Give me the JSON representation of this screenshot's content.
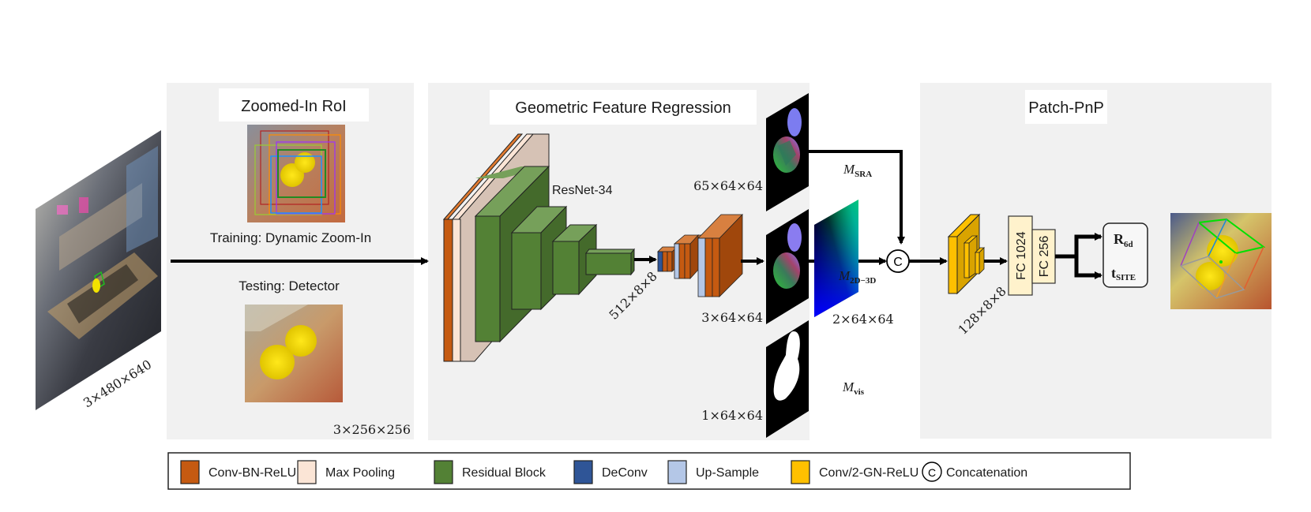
{
  "panels": {
    "roi": {
      "title": "Zoomed-In RoI",
      "training_label": "Training: Dynamic Zoom-In",
      "testing_label": "Testing: Detector",
      "output_dim": "3×256×256"
    },
    "gfr": {
      "title": "Geometric Feature Regression",
      "backbone_label": "ResNet-34",
      "bottleneck_dim": "512×8×8",
      "srа_dim": "65×64×64",
      "xyz_dim": "3×64×64",
      "mask_dim": "1×64×64"
    },
    "pnp": {
      "title": "Patch-PnP",
      "conv_dim": "128×8×8",
      "fc1_label": "FC 1024",
      "fc2_label": "FC 256",
      "rot_label": "R",
      "rot_sub": "6d",
      "trans_label": "t",
      "trans_sub": "SITE"
    }
  },
  "input": {
    "dim": "3×480×640"
  },
  "maps": {
    "sra": {
      "symbol": "M",
      "sub": "SRA"
    },
    "coord2d3d": {
      "symbol": "M",
      "sub": "2D−3D",
      "dim": "2×64×64"
    },
    "vis": {
      "symbol": "M",
      "sub": "vis"
    }
  },
  "concat_symbol": "C",
  "legend": [
    {
      "label": "Conv-BN-ReLU",
      "color": "#c55a11"
    },
    {
      "label": "Max Pooling",
      "color": "#fbe5d6"
    },
    {
      "label": "Residual Block",
      "color": "#538135"
    },
    {
      "label": "DeConv",
      "color": "#2f5597"
    },
    {
      "label": "Up-Sample",
      "color": "#b4c7e7"
    },
    {
      "label": "Conv/2-GN-ReLU",
      "color": "#ffc000"
    },
    {
      "label": "Concatenation",
      "symbol": "C"
    }
  ],
  "colors": {
    "panel_bg": "#f1f1f1",
    "conv": "#c55a11",
    "conv_dark": "#a0470c",
    "maxpool": "#fbe5d6",
    "maxpool_side": "#d6c2b5",
    "residual": "#538135",
    "residual_top": "#76a05a",
    "residual_side": "#446a2b",
    "deconv": "#2f5597",
    "upsample": "#b4c7e7",
    "gn": "#ffc000",
    "gn_dark": "#d9a300",
    "fc": "#fff2cc"
  }
}
